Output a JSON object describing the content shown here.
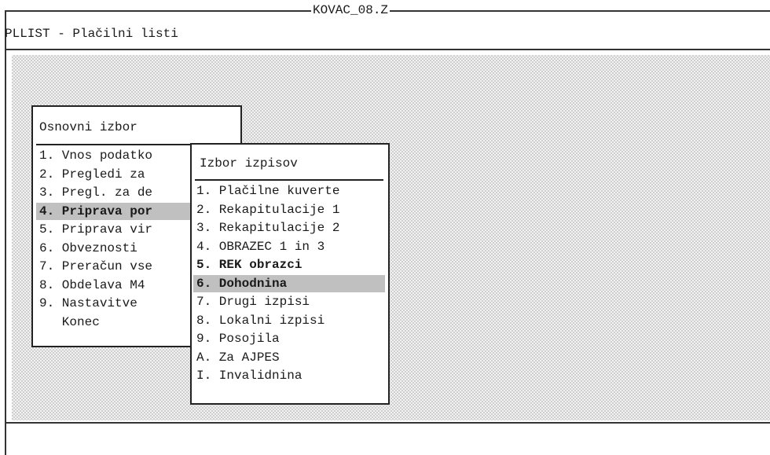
{
  "window": {
    "frame_title": "KOVAC_08.Z",
    "app_title": "PLLIST - Plačilni listi"
  },
  "main_menu": {
    "title": "Osnovni izbor",
    "items": [
      {
        "label": "1. Vnos podatko"
      },
      {
        "label": "2. Pregledi za"
      },
      {
        "label": "3. Pregl. za de"
      },
      {
        "label": "4. Priprava por",
        "selected": true
      },
      {
        "label": "5. Priprava vir"
      },
      {
        "label": "6. Obveznosti"
      },
      {
        "label": "7. Preračun vse"
      },
      {
        "label": "8. Obdelava M4"
      },
      {
        "label": "9. Nastavitve"
      },
      {
        "label": "   Konec"
      }
    ]
  },
  "submenu": {
    "title": "Izbor izpisov",
    "items": [
      {
        "label": "1. Plačilne kuverte"
      },
      {
        "label": "2. Rekapitulacije 1"
      },
      {
        "label": "3. Rekapitulacije 2"
      },
      {
        "label": "4. OBRAZEC 1 in 3"
      },
      {
        "label": "5. REK obrazci",
        "bold": true
      },
      {
        "label": "6. Dohodnina",
        "selected": true
      },
      {
        "label": "7. Drugi izpisi"
      },
      {
        "label": "8. Lokalni izpisi"
      },
      {
        "label": "9. Posojila"
      },
      {
        "label": "A. Za AJPES"
      },
      {
        "label": "I. Invalidnina"
      }
    ]
  }
}
